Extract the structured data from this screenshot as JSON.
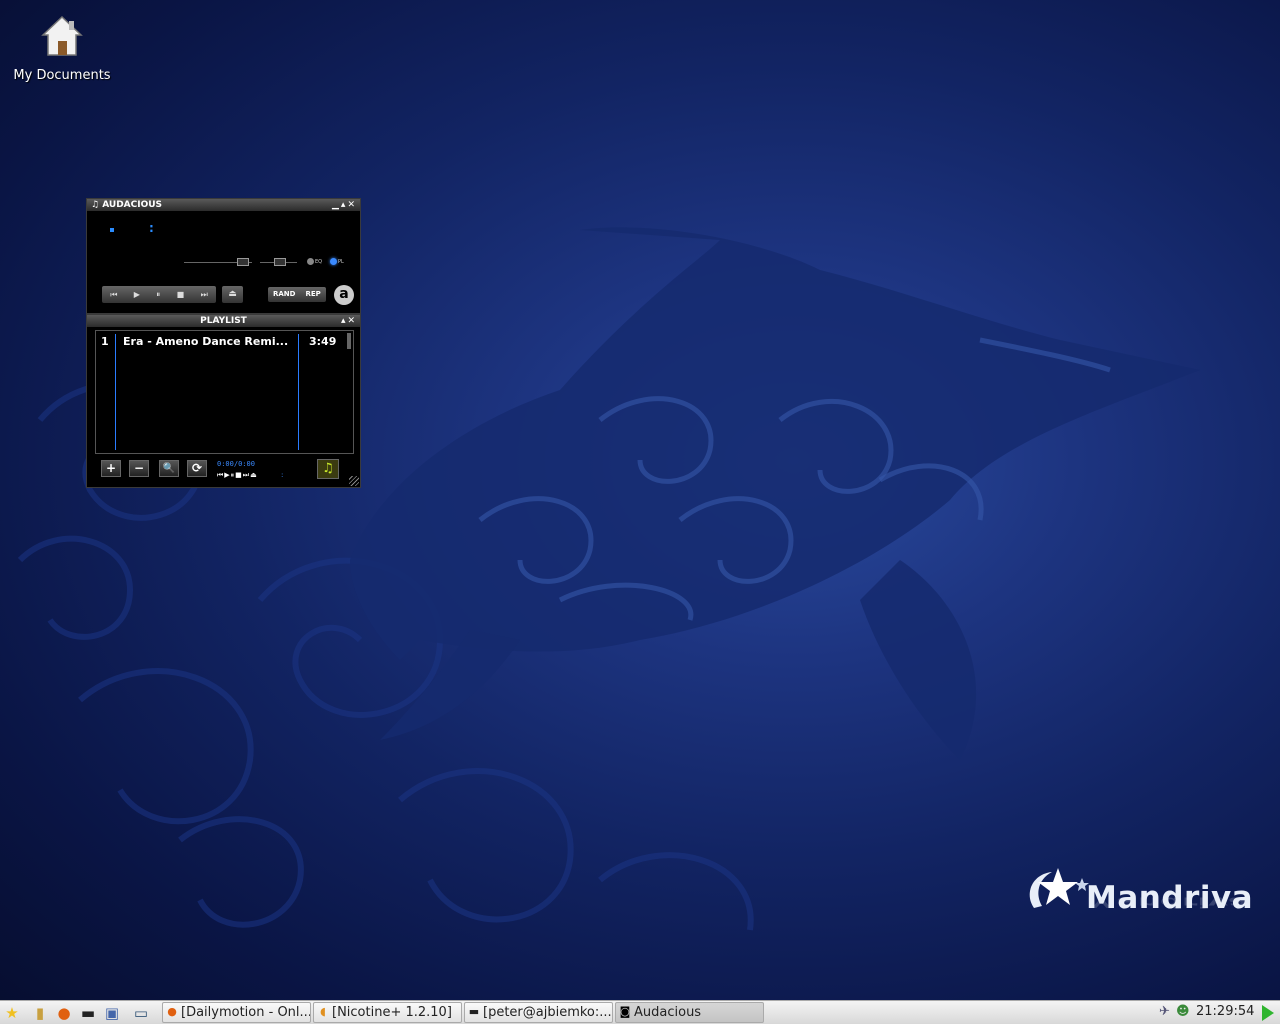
{
  "desktop": {
    "icons": [
      {
        "label": "My Documents",
        "icon": "home-icon"
      }
    ],
    "logo_text": "Mandriva"
  },
  "player": {
    "title": "AUDACIOUS",
    "title_buttons": "▁▴✕",
    "display_colon": ":",
    "eq_label": "EQ",
    "pl_label": "PL",
    "rand_label": "RAND",
    "rep_label": "REP",
    "logo_letter": "a",
    "controls": [
      "⏮",
      "▶",
      "⏸",
      "■",
      "⏭"
    ],
    "eject": "⏏",
    "eq_active": false,
    "pl_active": true
  },
  "playlist": {
    "title": "PLAYLIST",
    "title_buttons": "▴✕",
    "tracks": [
      {
        "num": "1",
        "name": "Era - Ameno Dance Remi...",
        "time": "3:49"
      }
    ],
    "time_info": "0:00/0:00",
    "mini_controls": "⏮▶⏸■⏭⏏",
    "mini_colon": ":",
    "buttons": {
      "add": "+",
      "remove": "−",
      "select": "🔍",
      "misc": "⟳",
      "list": "♫"
    }
  },
  "taskbar": {
    "quick_launch": [
      "star-icon",
      "file-manager-icon",
      "firefox-icon",
      "terminal-icon",
      "network-icon",
      "desktop-icon"
    ],
    "tasks": [
      {
        "label": "[Dailymotion - Onl...",
        "icon": "firefox-icon",
        "active": false
      },
      {
        "label": "[Nicotine+ 1.2.10]",
        "icon": "nicotine-icon",
        "active": false
      },
      {
        "label": "[peter@ajbiemko:...",
        "icon": "terminal-icon",
        "active": false
      },
      {
        "label": "Audacious",
        "icon": "audacious-icon",
        "active": true
      }
    ],
    "clock": "21:29:54"
  },
  "colors": {
    "accent_blue": "#2a8cff",
    "taskbar_bg": "#e6e6e6",
    "wallpaper_center": "#2a4a9e"
  }
}
